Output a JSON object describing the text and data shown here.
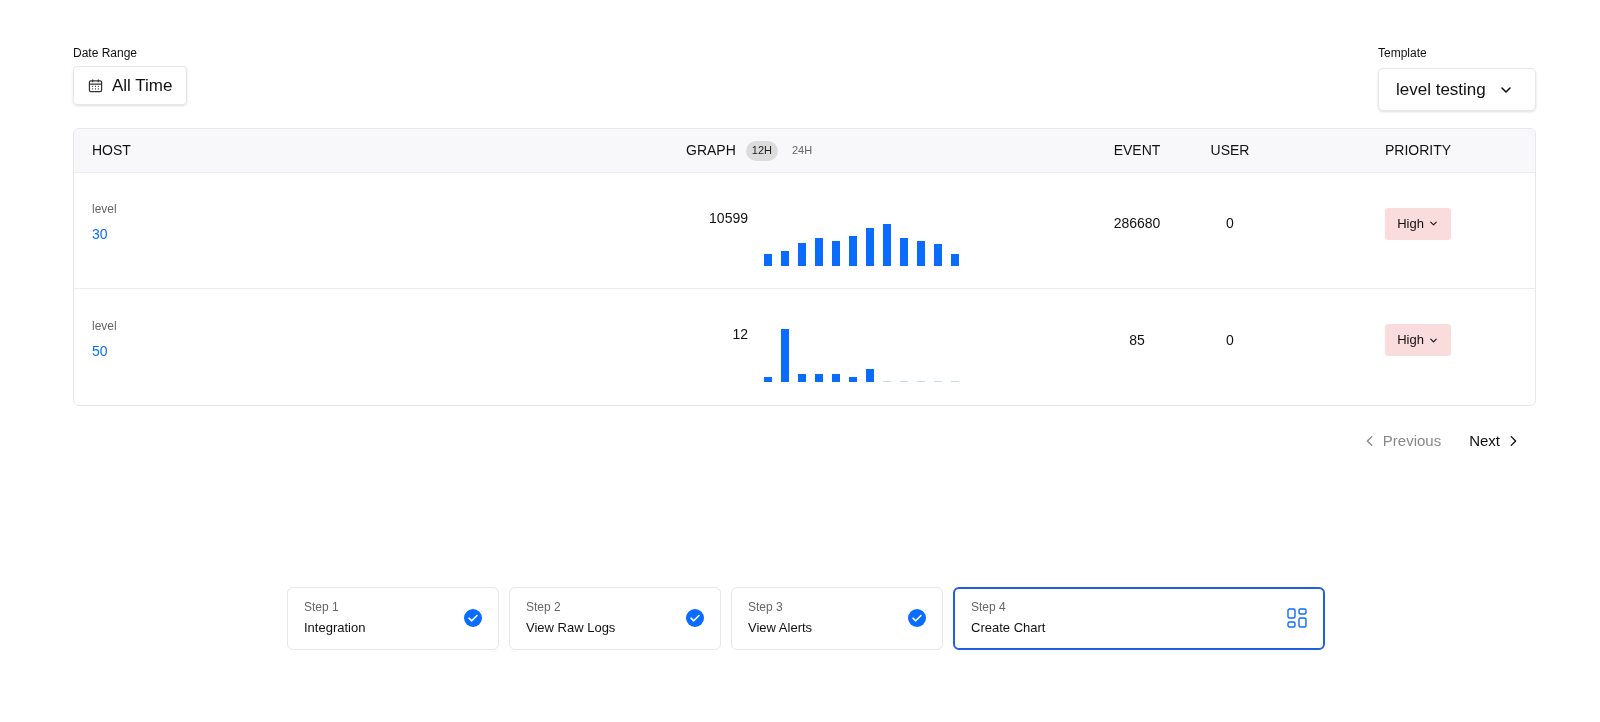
{
  "date_range": {
    "label": "Date Range",
    "value": "All Time"
  },
  "template": {
    "label": "Template",
    "value": "level testing"
  },
  "table": {
    "columns": {
      "host": "HOST",
      "graph": "GRAPH",
      "event": "EVENT",
      "user": "USER",
      "priority": "PRIORITY"
    },
    "ranges": [
      {
        "label": "12H",
        "selected": true
      },
      {
        "label": "24H",
        "selected": false
      }
    ],
    "rows": [
      {
        "host_label": "level",
        "host_value": "30",
        "graph_value": "10599",
        "event": "286680",
        "user": "0",
        "priority": "High"
      },
      {
        "host_label": "level",
        "host_value": "50",
        "graph_value": "12",
        "event": "85",
        "user": "0",
        "priority": "High"
      }
    ]
  },
  "pagination": {
    "previous": {
      "label": "Previous",
      "disabled": true
    },
    "next": {
      "label": "Next",
      "disabled": false
    }
  },
  "steps": [
    {
      "step": "Step 1",
      "title": "Integration",
      "kind": "done",
      "selected": false
    },
    {
      "step": "Step 2",
      "title": "View Raw Logs",
      "kind": "done",
      "selected": false
    },
    {
      "step": "Step 3",
      "title": "View Alerts",
      "kind": "done",
      "selected": false
    },
    {
      "step": "Step 4",
      "title": "Create Chart",
      "kind": "current",
      "selected": true
    }
  ]
}
